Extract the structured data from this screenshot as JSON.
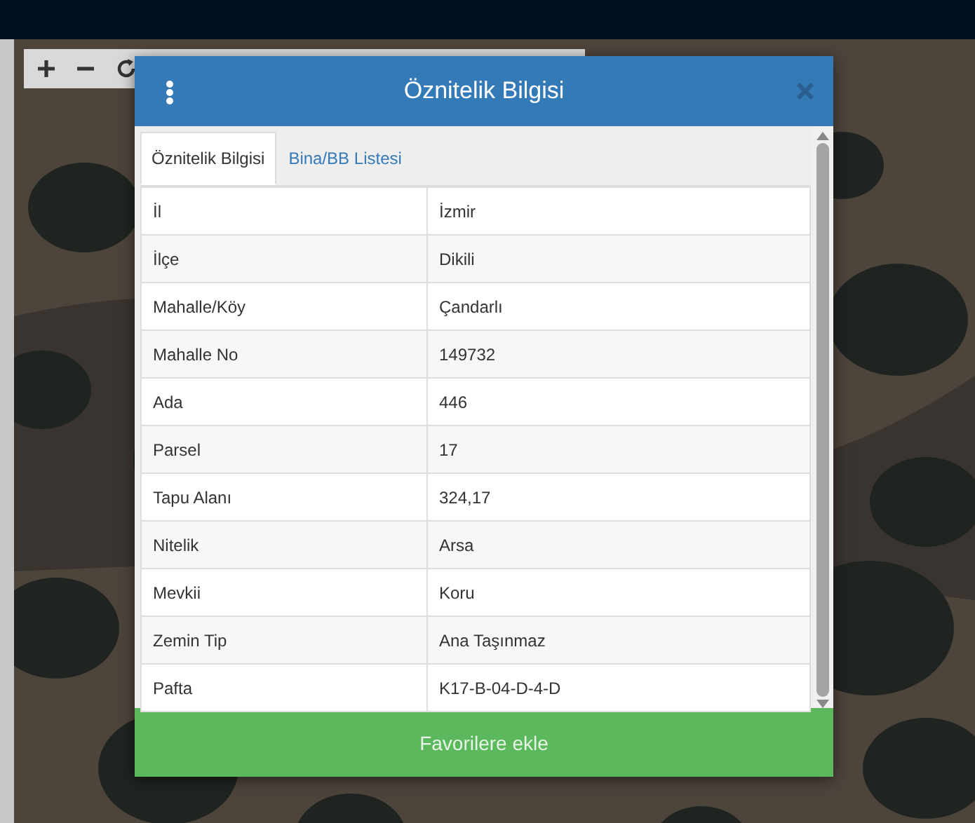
{
  "dialog": {
    "title": "Öznitelik Bilgisi"
  },
  "tabs": [
    {
      "label": "Öznitelik Bilgisi",
      "selected": true
    },
    {
      "label": "Bina/BB Listesi",
      "selected": false
    }
  ],
  "table": {
    "rows": [
      {
        "label": "İl",
        "value": "İzmir"
      },
      {
        "label": "İlçe",
        "value": "Dikili"
      },
      {
        "label": "Mahalle/Köy",
        "value": "Çandarlı"
      },
      {
        "label": "Mahalle No",
        "value": "149732"
      },
      {
        "label": "Ada",
        "value": "446"
      },
      {
        "label": "Parsel",
        "value": "17"
      },
      {
        "label": "Tapu Alanı",
        "value": "324,17"
      },
      {
        "label": "Nitelik",
        "value": "Arsa"
      },
      {
        "label": "Mevkii",
        "value": "Koru"
      },
      {
        "label": "Zemin Tip",
        "value": "Ana Taşınmaz"
      },
      {
        "label": "Pafta",
        "value": "K17-B-04-D-4-D"
      }
    ]
  },
  "footer_button": {
    "label": "Favorilere ekle"
  }
}
